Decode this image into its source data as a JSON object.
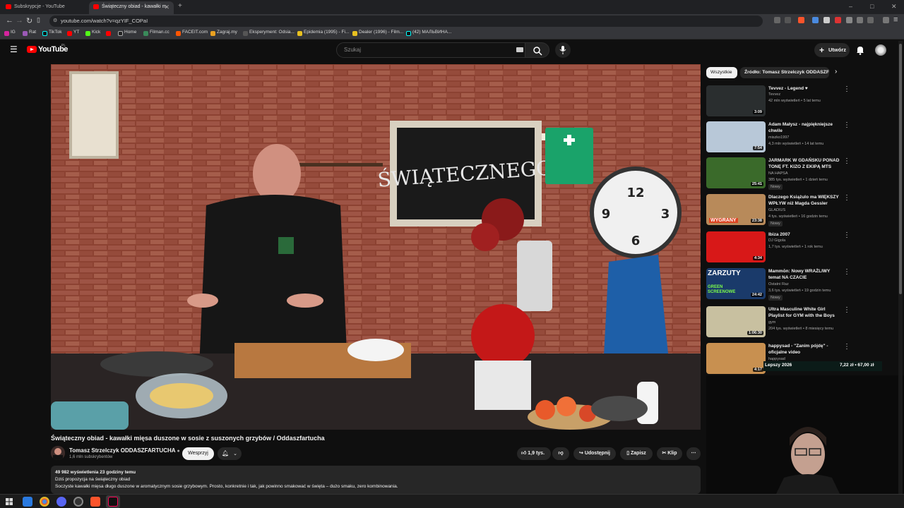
{
  "browser": {
    "tabs": [
      {
        "title": "Subskrypcje - YouTube",
        "active": false
      },
      {
        "title": "Świąteczny obiad - kawałki m",
        "active": true
      }
    ],
    "url": "youtube.com/watch?v=qzYIF_COPaI",
    "bookmarks": [
      "IG",
      "Rat",
      "TikTok",
      "YT",
      "Kick",
      "",
      "Home",
      "Filman.cc",
      "FACEIT.com",
      "Zagraj.my",
      "Eksperyment: Odsia...",
      "Epidemia (1995) - Fi...",
      "Dealer (1996) - Film...",
      "(42) МАЛЬВИНА..."
    ]
  },
  "youtube": {
    "logo": "YouTube",
    "country": "PL",
    "search_placeholder": "Szukaj",
    "create_label": "Utwórz"
  },
  "video": {
    "chalkboard_text": "ŚWIĄTECZNEGO",
    "clock_numbers": [
      "12",
      "3",
      "6",
      "9"
    ],
    "title": "Świąteczny obiad - kawałki mięsa duszone w sosie z suszonych grzybów / Oddaszfartucha",
    "channel": "Tomasz Strzelczyk ODDASZFARTUCHA",
    "subscribers": "1,6 mln subskrybentów",
    "support_label": "Wesprzyj",
    "likes": "1,9 tys.",
    "share_label": "Udostępnij",
    "save_label": "Zapisz",
    "clip_label": "Klip",
    "views_line": "49 982 wyświetlenia  23 godziny temu",
    "desc_line1": "Dziś propozycja na świąteczny obiad",
    "desc_line2": "Soczyste kawałki mięsa długo duszone w aromatycznym sosie grzybowym. Prosto, konkretnie i tak, jak powinno smakować w święta – dużo smaku, zero kombinowania."
  },
  "sidebar": {
    "chips": [
      "Wszystkie",
      "Źródło: Tomasz Strzelczyk ODDASZFA"
    ],
    "recommendations": [
      {
        "title": "Tevvez - Legend ♥",
        "channel": "Tevvez",
        "meta": "42 mln wyświetleń • 5 lat temu",
        "duration": "3:09",
        "badge": "",
        "thumb": "#2a2e2f"
      },
      {
        "title": "Adam Małysz - najpiękniejsze chwile",
        "channel": "miszko1997",
        "meta": "4,3 mln wyświetleń • 14 lat temu",
        "duration": "7:54",
        "badge": "",
        "thumb": "#b8c8d8"
      },
      {
        "title": "JARMARK W GDAŃSKU PONAD TONĘ FT. KIZO Z EKIPĄ MTS",
        "channel": "NA HAPSA",
        "meta": "385 tys. wyświetleń • 1 dzień temu",
        "duration": "25:41",
        "badge": "Nowy",
        "thumb": "#3a6a2a"
      },
      {
        "title": "Dlaczego Książulo ma WIĘKSZY WPŁYW niż Magda Gessler",
        "channel": "GLADIUS",
        "meta": "4 tys. wyświetleń • 16 godzin temu",
        "duration": "23:38",
        "badge": "Nowy",
        "thumb": "#b88a5a"
      },
      {
        "title": "Ibiza 2007",
        "channel": "DJ Gigola",
        "meta": "1,7 tys. wyświetleń • 1 rok temu",
        "duration": "4:34",
        "badge": "",
        "thumb": "#d81818"
      },
      {
        "title": "Mammōn: Nowy WRAŻLIWY temat NA CZACIE",
        "channel": "Ostatni Raz",
        "meta": "3,6 tys. wyświetleń • 19 godzin temu",
        "duration": "24:42",
        "badge": "Nowy",
        "thumb": "#1a3a6a"
      },
      {
        "title": "Ultra Masculine White Girl Playlist for GYM with the Boys",
        "channel": "gym",
        "meta": "204 tys. wyświetleń • 8 miesięcy temu",
        "duration": "1:06:30",
        "badge": "",
        "thumb": "#c8c0a0"
      },
      {
        "title": "happysad - \"Zanim pójdę\" - oficjalne video",
        "channel": "happysad",
        "meta": "1 mln wyświetleń • 12 lat temu",
        "duration": "4:17",
        "badge": "",
        "thumb": "#c89050"
      }
    ],
    "thumb_texts": [
      "ZARZUTY",
      "GREEN SCREENOWE",
      "WYGRANY"
    ],
    "gold_label": "Lepszy 2026",
    "gold_price": "7,22 zł • 67,00 zł"
  },
  "colors": {
    "accent_red": "#ff0000",
    "background": "#0f0f0f",
    "chip_active": "#f1f1f1"
  }
}
